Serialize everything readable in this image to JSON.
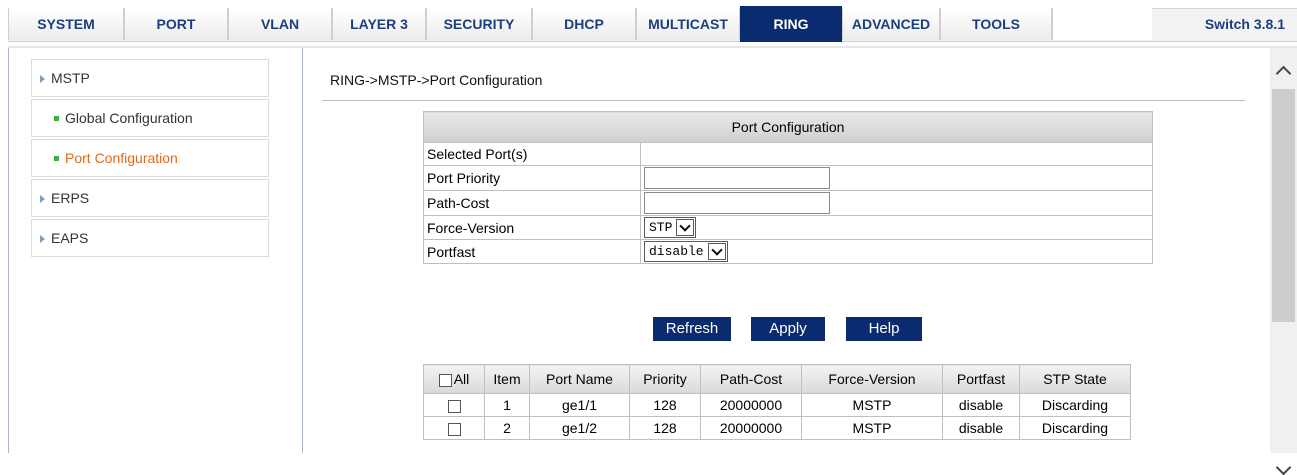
{
  "nav": {
    "tabs": [
      {
        "label": "SYSTEM"
      },
      {
        "label": "PORT"
      },
      {
        "label": "VLAN"
      },
      {
        "label": "LAYER 3"
      },
      {
        "label": "SECURITY"
      },
      {
        "label": "DHCP"
      },
      {
        "label": "MULTICAST"
      },
      {
        "label": "RING"
      },
      {
        "label": "ADVANCED"
      },
      {
        "label": "TOOLS"
      }
    ],
    "active_tab": "RING",
    "version": "Switch 3.8.1"
  },
  "sidebar": {
    "items": [
      {
        "label": "MSTP"
      },
      {
        "label": "Global Configuration"
      },
      {
        "label": "Port Configuration"
      },
      {
        "label": "ERPS"
      },
      {
        "label": "EAPS"
      }
    ]
  },
  "breadcrumb": "RING->MSTP->Port Configuration",
  "config": {
    "title": "Port Configuration",
    "rows": [
      {
        "label": "Selected Port(s)",
        "value": ""
      },
      {
        "label": "Port Priority",
        "value": ""
      },
      {
        "label": "Path-Cost",
        "value": ""
      },
      {
        "label": "Force-Version",
        "value": "STP"
      },
      {
        "label": "Portfast",
        "value": "disable"
      }
    ]
  },
  "buttons": {
    "refresh": "Refresh",
    "apply": "Apply",
    "help": "Help"
  },
  "table": {
    "headers": [
      "All",
      "Item",
      "Port Name",
      "Priority",
      "Path-Cost",
      "Force-Version",
      "Portfast",
      "STP State"
    ],
    "rows": [
      {
        "item": "1",
        "port": "ge1/1",
        "priority": "128",
        "path_cost": "20000000",
        "force_version": "MSTP",
        "portfast": "disable",
        "state": "Discarding"
      },
      {
        "item": "2",
        "port": "ge1/2",
        "priority": "128",
        "path_cost": "20000000",
        "force_version": "MSTP",
        "portfast": "disable",
        "state": "Discarding"
      }
    ]
  },
  "colors": {
    "nav_active": "#0b2b70",
    "nav_text": "#1c3e7e",
    "sidebar_current": "#e46a1a",
    "button_bg": "#0b2b70"
  }
}
